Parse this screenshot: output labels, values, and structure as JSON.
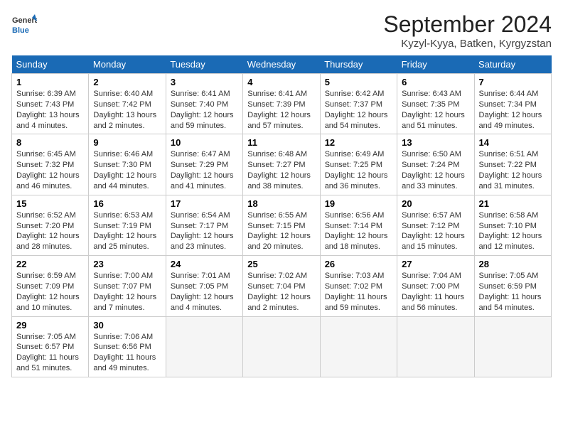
{
  "header": {
    "logo_line1": "General",
    "logo_line2": "Blue",
    "month": "September 2024",
    "location": "Kyzyl-Kyya, Batken, Kyrgyzstan"
  },
  "days_of_week": [
    "Sunday",
    "Monday",
    "Tuesday",
    "Wednesday",
    "Thursday",
    "Friday",
    "Saturday"
  ],
  "weeks": [
    [
      {
        "day": 1,
        "sunrise": "6:39 AM",
        "sunset": "7:43 PM",
        "daylight": "13 hours and 4 minutes."
      },
      {
        "day": 2,
        "sunrise": "6:40 AM",
        "sunset": "7:42 PM",
        "daylight": "13 hours and 2 minutes."
      },
      {
        "day": 3,
        "sunrise": "6:41 AM",
        "sunset": "7:40 PM",
        "daylight": "12 hours and 59 minutes."
      },
      {
        "day": 4,
        "sunrise": "6:41 AM",
        "sunset": "7:39 PM",
        "daylight": "12 hours and 57 minutes."
      },
      {
        "day": 5,
        "sunrise": "6:42 AM",
        "sunset": "7:37 PM",
        "daylight": "12 hours and 54 minutes."
      },
      {
        "day": 6,
        "sunrise": "6:43 AM",
        "sunset": "7:35 PM",
        "daylight": "12 hours and 51 minutes."
      },
      {
        "day": 7,
        "sunrise": "6:44 AM",
        "sunset": "7:34 PM",
        "daylight": "12 hours and 49 minutes."
      }
    ],
    [
      {
        "day": 8,
        "sunrise": "6:45 AM",
        "sunset": "7:32 PM",
        "daylight": "12 hours and 46 minutes."
      },
      {
        "day": 9,
        "sunrise": "6:46 AM",
        "sunset": "7:30 PM",
        "daylight": "12 hours and 44 minutes."
      },
      {
        "day": 10,
        "sunrise": "6:47 AM",
        "sunset": "7:29 PM",
        "daylight": "12 hours and 41 minutes."
      },
      {
        "day": 11,
        "sunrise": "6:48 AM",
        "sunset": "7:27 PM",
        "daylight": "12 hours and 38 minutes."
      },
      {
        "day": 12,
        "sunrise": "6:49 AM",
        "sunset": "7:25 PM",
        "daylight": "12 hours and 36 minutes."
      },
      {
        "day": 13,
        "sunrise": "6:50 AM",
        "sunset": "7:24 PM",
        "daylight": "12 hours and 33 minutes."
      },
      {
        "day": 14,
        "sunrise": "6:51 AM",
        "sunset": "7:22 PM",
        "daylight": "12 hours and 31 minutes."
      }
    ],
    [
      {
        "day": 15,
        "sunrise": "6:52 AM",
        "sunset": "7:20 PM",
        "daylight": "12 hours and 28 minutes."
      },
      {
        "day": 16,
        "sunrise": "6:53 AM",
        "sunset": "7:19 PM",
        "daylight": "12 hours and 25 minutes."
      },
      {
        "day": 17,
        "sunrise": "6:54 AM",
        "sunset": "7:17 PM",
        "daylight": "12 hours and 23 minutes."
      },
      {
        "day": 18,
        "sunrise": "6:55 AM",
        "sunset": "7:15 PM",
        "daylight": "12 hours and 20 minutes."
      },
      {
        "day": 19,
        "sunrise": "6:56 AM",
        "sunset": "7:14 PM",
        "daylight": "12 hours and 18 minutes."
      },
      {
        "day": 20,
        "sunrise": "6:57 AM",
        "sunset": "7:12 PM",
        "daylight": "12 hours and 15 minutes."
      },
      {
        "day": 21,
        "sunrise": "6:58 AM",
        "sunset": "7:10 PM",
        "daylight": "12 hours and 12 minutes."
      }
    ],
    [
      {
        "day": 22,
        "sunrise": "6:59 AM",
        "sunset": "7:09 PM",
        "daylight": "12 hours and 10 minutes."
      },
      {
        "day": 23,
        "sunrise": "7:00 AM",
        "sunset": "7:07 PM",
        "daylight": "12 hours and 7 minutes."
      },
      {
        "day": 24,
        "sunrise": "7:01 AM",
        "sunset": "7:05 PM",
        "daylight": "12 hours and 4 minutes."
      },
      {
        "day": 25,
        "sunrise": "7:02 AM",
        "sunset": "7:04 PM",
        "daylight": "12 hours and 2 minutes."
      },
      {
        "day": 26,
        "sunrise": "7:03 AM",
        "sunset": "7:02 PM",
        "daylight": "11 hours and 59 minutes."
      },
      {
        "day": 27,
        "sunrise": "7:04 AM",
        "sunset": "7:00 PM",
        "daylight": "11 hours and 56 minutes."
      },
      {
        "day": 28,
        "sunrise": "7:05 AM",
        "sunset": "6:59 PM",
        "daylight": "11 hours and 54 minutes."
      }
    ],
    [
      {
        "day": 29,
        "sunrise": "7:05 AM",
        "sunset": "6:57 PM",
        "daylight": "11 hours and 51 minutes."
      },
      {
        "day": 30,
        "sunrise": "7:06 AM",
        "sunset": "6:56 PM",
        "daylight": "11 hours and 49 minutes."
      },
      null,
      null,
      null,
      null,
      null
    ]
  ]
}
